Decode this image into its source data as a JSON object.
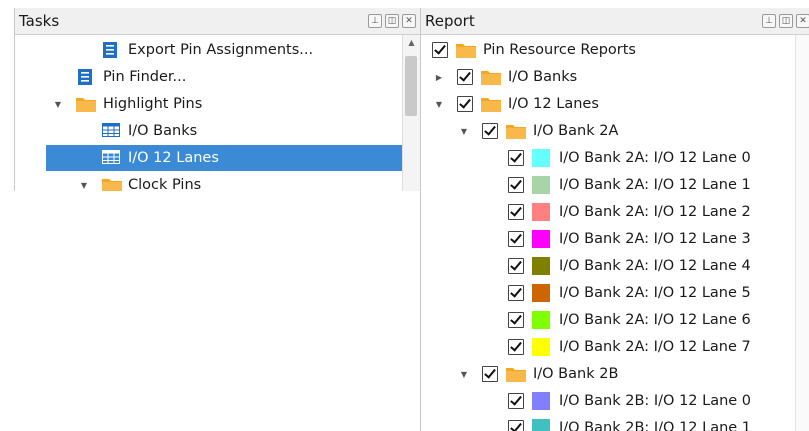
{
  "tasks": {
    "title": "Tasks",
    "items": [
      {
        "label": "Export Pin Assignments...",
        "icon": "document-list-icon",
        "expanded": null
      },
      {
        "label": "Pin Finder...",
        "icon": "document-list-icon",
        "expanded": null
      },
      {
        "label": "Highlight Pins",
        "icon": "folder-icon",
        "expanded": true
      },
      {
        "label": "I/O Banks",
        "icon": "table-icon",
        "expanded": null
      },
      {
        "label": "I/O 12 Lanes",
        "icon": "table-icon",
        "expanded": null,
        "selected": true
      },
      {
        "label": "Clock Pins",
        "icon": "folder-icon",
        "expanded": true
      }
    ]
  },
  "report": {
    "title": "Report",
    "items": [
      {
        "label": "Pin Resource Reports",
        "icon": "folder-icon"
      },
      {
        "label": "I/O Banks",
        "icon": "folder-icon",
        "expanded": false
      },
      {
        "label": "I/O 12 Lanes",
        "icon": "folder-icon",
        "expanded": true
      },
      {
        "label": "I/O Bank 2A",
        "icon": "folder-icon",
        "expanded": true
      },
      {
        "label": "I/O Bank 2A: I/O 12 Lane 0",
        "color": "#66ffff"
      },
      {
        "label": "I/O Bank 2A: I/O 12 Lane 1",
        "color": "#a8d4a8"
      },
      {
        "label": "I/O Bank 2A: I/O 12 Lane 2",
        "color": "#ff8080"
      },
      {
        "label": "I/O Bank 2A: I/O 12 Lane 3",
        "color": "#ff00ff"
      },
      {
        "label": "I/O Bank 2A: I/O 12 Lane 4",
        "color": "#808000"
      },
      {
        "label": "I/O Bank 2A: I/O 12 Lane 5",
        "color": "#cc6600"
      },
      {
        "label": "I/O Bank 2A: I/O 12 Lane 6",
        "color": "#80ff00"
      },
      {
        "label": "I/O Bank 2A: I/O 12 Lane 7",
        "color": "#ffff00"
      },
      {
        "label": "I/O Bank 2B",
        "icon": "folder-icon",
        "expanded": true
      },
      {
        "label": "I/O Bank 2B: I/O 12 Lane 0",
        "color": "#8080ff"
      },
      {
        "label": "I/O Bank 2B: I/O 12 Lane 1",
        "color": "#40c0c0"
      }
    ]
  },
  "colors": {
    "selection": "#3b8ad6",
    "folder": "#f5a623",
    "doc_icon": "#1f6fc4"
  }
}
